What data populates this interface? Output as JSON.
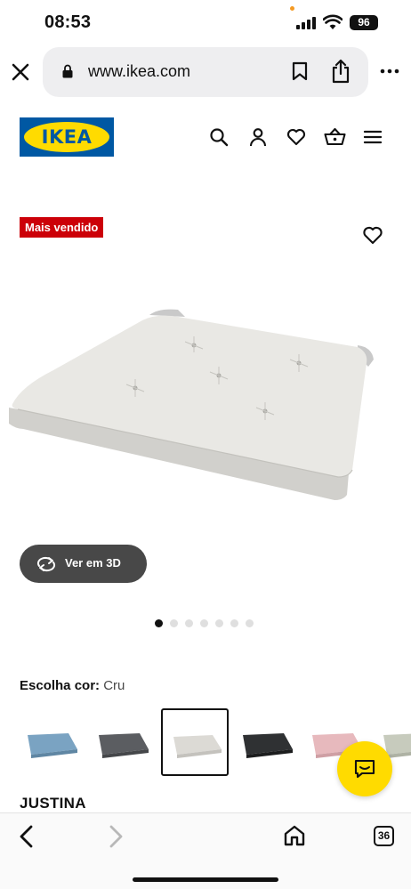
{
  "status_bar": {
    "time": "08:53",
    "battery": "96"
  },
  "browser": {
    "url": "www.ikea.com"
  },
  "header": {
    "logo_text": "IKEA"
  },
  "product": {
    "badge": "Mais vendido",
    "view_3d_label": "Ver em 3D",
    "carousel": {
      "count": 7,
      "active_index": 0
    },
    "color_prompt": "Escolha cor:",
    "color_value": "Cru",
    "swatches": [
      {
        "color": "#7aa3c2"
      },
      {
        "color": "#5b5d61"
      },
      {
        "color": "#dcdad5",
        "selected": true
      },
      {
        "color": "#2f3133"
      },
      {
        "color": "#e7b9bd"
      },
      {
        "color": "#c7cbbd"
      }
    ],
    "name": "JUSTINA"
  },
  "toolbar": {
    "tabs_count": "36"
  },
  "colors": {
    "ikea_blue": "#0058a3",
    "ikea_yellow": "#ffdb00",
    "badge_red": "#cc0008"
  }
}
